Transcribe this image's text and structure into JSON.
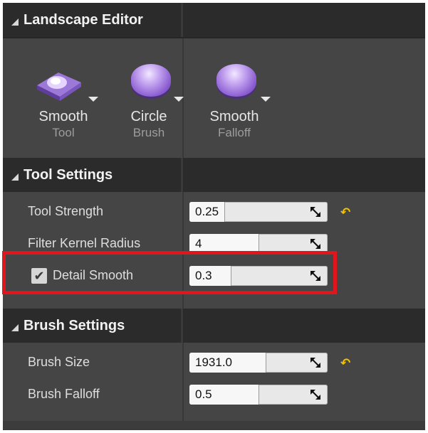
{
  "landscape_editor": {
    "title": "Landscape Editor",
    "tools": [
      {
        "label": "Smooth",
        "sublabel": "Tool",
        "icon": "terrain-icon"
      },
      {
        "label": "Circle",
        "sublabel": "Brush",
        "icon": "brush-knob-icon"
      },
      {
        "label": "Smooth",
        "sublabel": "Falloff",
        "icon": "falloff-knob-icon"
      }
    ]
  },
  "tool_settings": {
    "title": "Tool Settings",
    "tool_strength": {
      "label": "Tool Strength",
      "value": "0.25",
      "fill_fraction": 0.25
    },
    "filter_kernel_radius": {
      "label": "Filter Kernel Radius",
      "value": "4",
      "fill_fraction": 0.5
    },
    "detail_smooth": {
      "label": "Detail Smooth",
      "value": "0.3",
      "checked": true,
      "fill_fraction": 0.3
    }
  },
  "brush_settings": {
    "title": "Brush Settings",
    "brush_size": {
      "label": "Brush Size",
      "value": "1931.0",
      "fill_fraction": 0.55
    },
    "brush_falloff": {
      "label": "Brush Falloff",
      "value": "0.5",
      "fill_fraction": 0.5
    }
  },
  "colors": {
    "panel_bg": "#454545",
    "header_bg": "#2b2b2b",
    "highlight": "#e1161d",
    "reset_arrow": "#f0c400",
    "knob_purple": "#8d5fd2"
  }
}
